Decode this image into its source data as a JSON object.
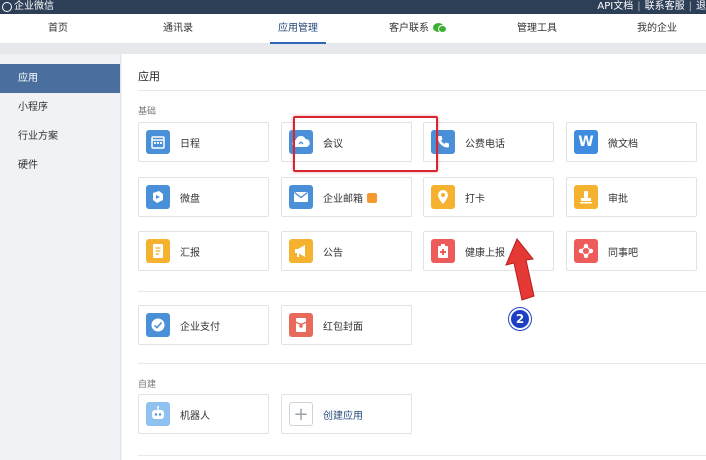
{
  "topbar": {
    "brand": "企业微信",
    "links": [
      "API文档",
      "联系客服",
      "退"
    ]
  },
  "nav": {
    "items": [
      "首页",
      "通讯录",
      "应用管理",
      "客户联系",
      "管理工具",
      "我的企业"
    ],
    "active": "应用管理"
  },
  "sidebar": {
    "items": [
      "应用",
      "小程序",
      "行业方案",
      "硬件"
    ],
    "active": "应用"
  },
  "main": {
    "title": "应用",
    "sections": {
      "basic": "基础",
      "custom": "自建"
    },
    "apps": {
      "schedule": "日程",
      "meeting": "会议",
      "paid_call": "公费电话",
      "wedoc": "微文档",
      "wedrive": "微盘",
      "email": "企业邮箱",
      "checkin": "打卡",
      "approval": "审批",
      "report": "汇报",
      "announcement": "公告",
      "health_report": "健康上报",
      "colleague_bar": "同事吧",
      "enterprise_pay": "企业支付",
      "red_packet_cover": "红包封面",
      "robot": "机器人",
      "create_app": "创建应用"
    }
  },
  "annotation": {
    "step_number": "2"
  },
  "colors": {
    "topbar_bg": "#2d3e57",
    "sidebar_active": "#4a6f9e",
    "highlight_border": "#d8262f",
    "marker_blue": "#1c3fc4",
    "icon_blue": "#4a90d9",
    "icon_orange": "#f4b22e",
    "icon_red": "#ee5b5b"
  },
  "icons": {
    "schedule": "calendar-icon",
    "meeting": "cloud-icon",
    "paid_call": "phone-icon",
    "wedoc": "w-letter-icon",
    "wedrive": "drive-icon",
    "email": "envelope-icon",
    "checkin": "location-pin-icon",
    "approval": "stamp-icon",
    "report": "document-icon",
    "announcement": "megaphone-icon",
    "health_report": "medical-kit-icon",
    "colleague_bar": "diamond-network-icon",
    "enterprise_pay": "payment-icon",
    "red_packet_cover": "red-packet-icon",
    "robot": "robot-icon",
    "create_app": "plus-icon"
  }
}
